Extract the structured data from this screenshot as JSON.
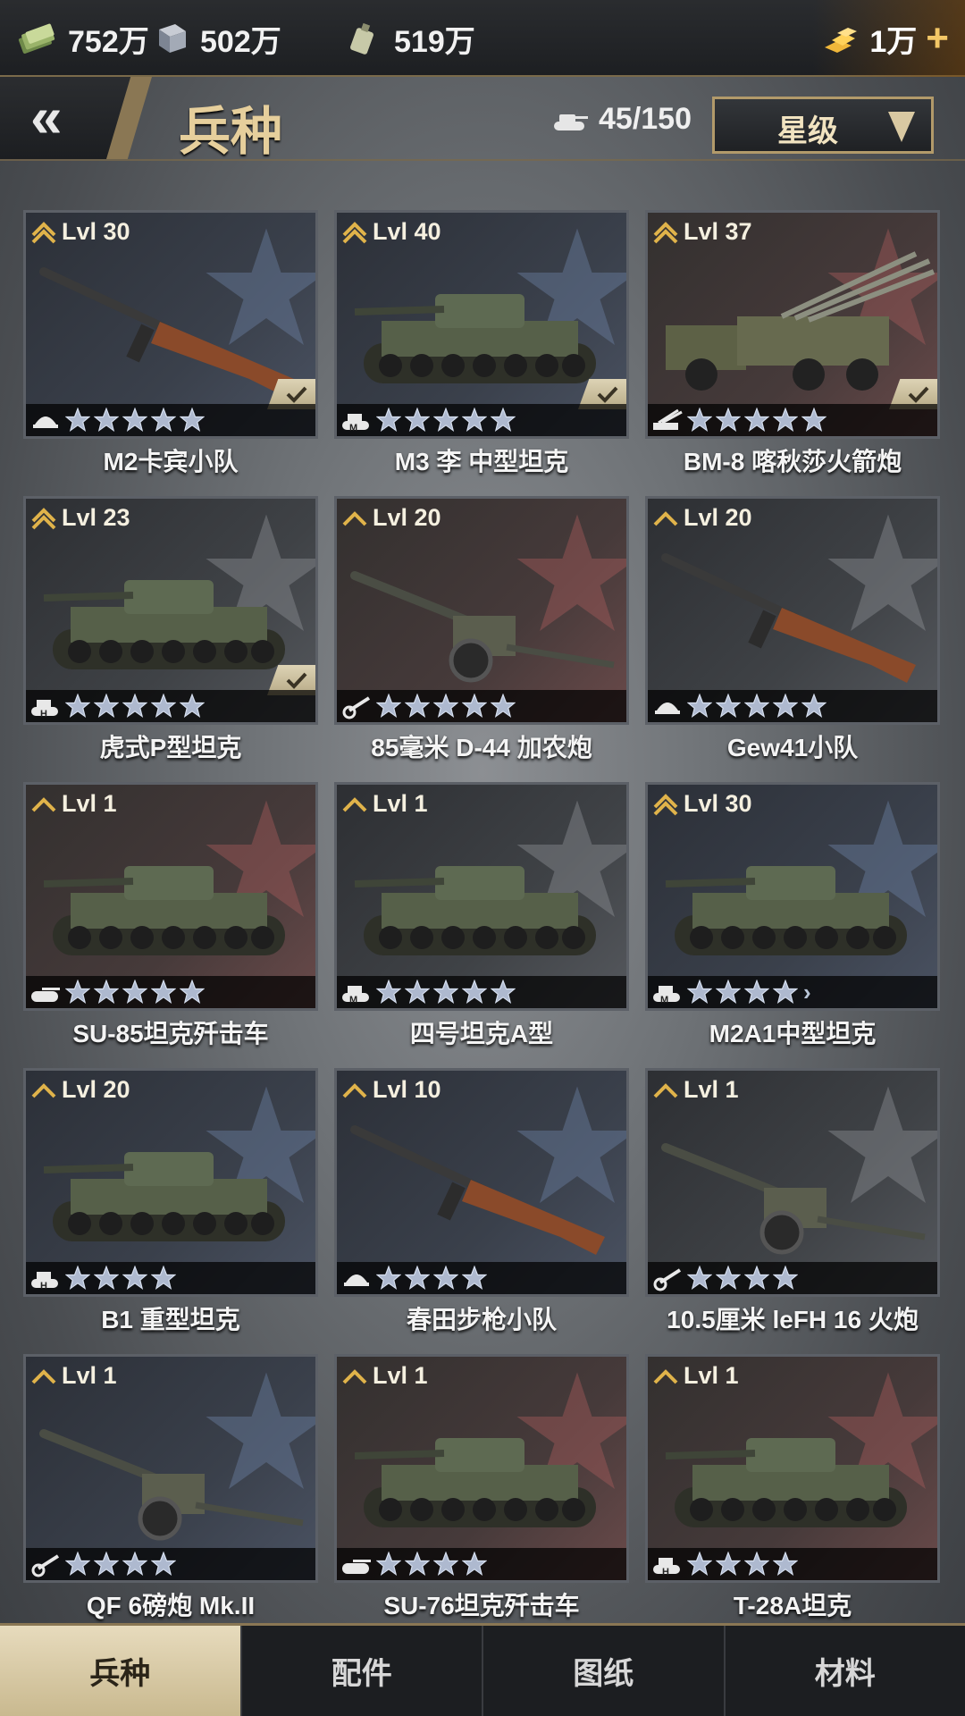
{
  "resources": {
    "cash": "752万",
    "steel": "502万",
    "fuel": "519万",
    "gold": "1万",
    "cash_icon": "cash-stack-icon",
    "steel_icon": "steel-block-icon",
    "fuel_icon": "fuel-canister-icon",
    "gold_icon": "gold-bars-icon"
  },
  "header": {
    "back_label": "«",
    "title": "兵种",
    "unit_count": "45/150",
    "sort_label": "星级"
  },
  "units": [
    {
      "name": "M2卡宾小队",
      "level": "Lvl 30",
      "rank": 2,
      "type": "infantry",
      "stars": 5,
      "max_stars": 5,
      "owned": true,
      "theme": "blue",
      "art": "rifle"
    },
    {
      "name": "M3 李 中型坦克",
      "level": "Lvl 40",
      "rank": 2,
      "type": "medium-tank",
      "stars": 5,
      "max_stars": 5,
      "owned": true,
      "theme": "blue",
      "art": "tank"
    },
    {
      "name": "BM-8 喀秋莎火箭炮",
      "level": "Lvl 37",
      "rank": 2,
      "type": "rocket-artillery",
      "stars": 5,
      "max_stars": 5,
      "owned": true,
      "theme": "red",
      "art": "truck"
    },
    {
      "name": "虎式P型坦克",
      "level": "Lvl 23",
      "rank": 2,
      "type": "heavy-tank",
      "stars": 5,
      "max_stars": 5,
      "owned": true,
      "theme": "gray",
      "art": "tank"
    },
    {
      "name": "85毫米 D-44 加农炮",
      "level": "Lvl 20",
      "rank": 1,
      "type": "artillery",
      "stars": 5,
      "max_stars": 5,
      "owned": false,
      "theme": "red",
      "art": "gun"
    },
    {
      "name": "Gew41小队",
      "level": "Lvl 20",
      "rank": 1,
      "type": "infantry",
      "stars": 5,
      "max_stars": 5,
      "owned": false,
      "theme": "gray",
      "art": "rifle"
    },
    {
      "name": "SU-85坦克歼击车",
      "level": "Lvl 1",
      "rank": 1,
      "type": "tank-destroyer",
      "stars": 5,
      "max_stars": 5,
      "owned": false,
      "theme": "red",
      "art": "tank"
    },
    {
      "name": "四号坦克A型",
      "level": "Lvl 1",
      "rank": 1,
      "type": "medium-tank",
      "stars": 5,
      "max_stars": 5,
      "owned": false,
      "theme": "gray",
      "art": "tank"
    },
    {
      "name": "M2A1中型坦克",
      "level": "Lvl 30",
      "rank": 2,
      "type": "medium-tank",
      "stars": 4,
      "max_stars": 4,
      "owned": false,
      "theme": "blue",
      "art": "tank",
      "more": true
    },
    {
      "name": "B1 重型坦克",
      "level": "Lvl 20",
      "rank": 1,
      "type": "heavy-tank",
      "stars": 4,
      "max_stars": 4,
      "owned": false,
      "theme": "blue",
      "art": "tank"
    },
    {
      "name": "春田步枪小队",
      "level": "Lvl 10",
      "rank": 1,
      "type": "infantry",
      "stars": 4,
      "max_stars": 4,
      "owned": false,
      "theme": "blue",
      "art": "rifle"
    },
    {
      "name": "10.5厘米 leFH 16 火炮",
      "level": "Lvl 1",
      "rank": 1,
      "type": "artillery",
      "stars": 4,
      "max_stars": 4,
      "owned": false,
      "theme": "gray",
      "art": "gun"
    },
    {
      "name": "QF 6磅炮 Mk.II",
      "level": "Lvl 1",
      "rank": 1,
      "type": "artillery",
      "stars": 4,
      "max_stars": 4,
      "owned": false,
      "theme": "blue",
      "art": "gun"
    },
    {
      "name": "SU-76坦克歼击车",
      "level": "Lvl 1",
      "rank": 1,
      "type": "tank-destroyer",
      "stars": 4,
      "max_stars": 4,
      "owned": false,
      "theme": "red",
      "art": "tank"
    },
    {
      "name": "T-28A坦克",
      "level": "Lvl 1",
      "rank": 1,
      "type": "heavy-tank",
      "stars": 4,
      "max_stars": 4,
      "owned": false,
      "theme": "red",
      "art": "tank"
    }
  ],
  "tabs": [
    {
      "label": "兵种",
      "active": true
    },
    {
      "label": "配件",
      "active": false
    },
    {
      "label": "图纸",
      "active": false
    },
    {
      "label": "材料",
      "active": false
    }
  ],
  "colors": {
    "accent_gold": "#e6cf9c",
    "star_blue": "#aeb9cf",
    "rank_gold": "#e0b34a",
    "tab_active": "#e7dbbd"
  }
}
